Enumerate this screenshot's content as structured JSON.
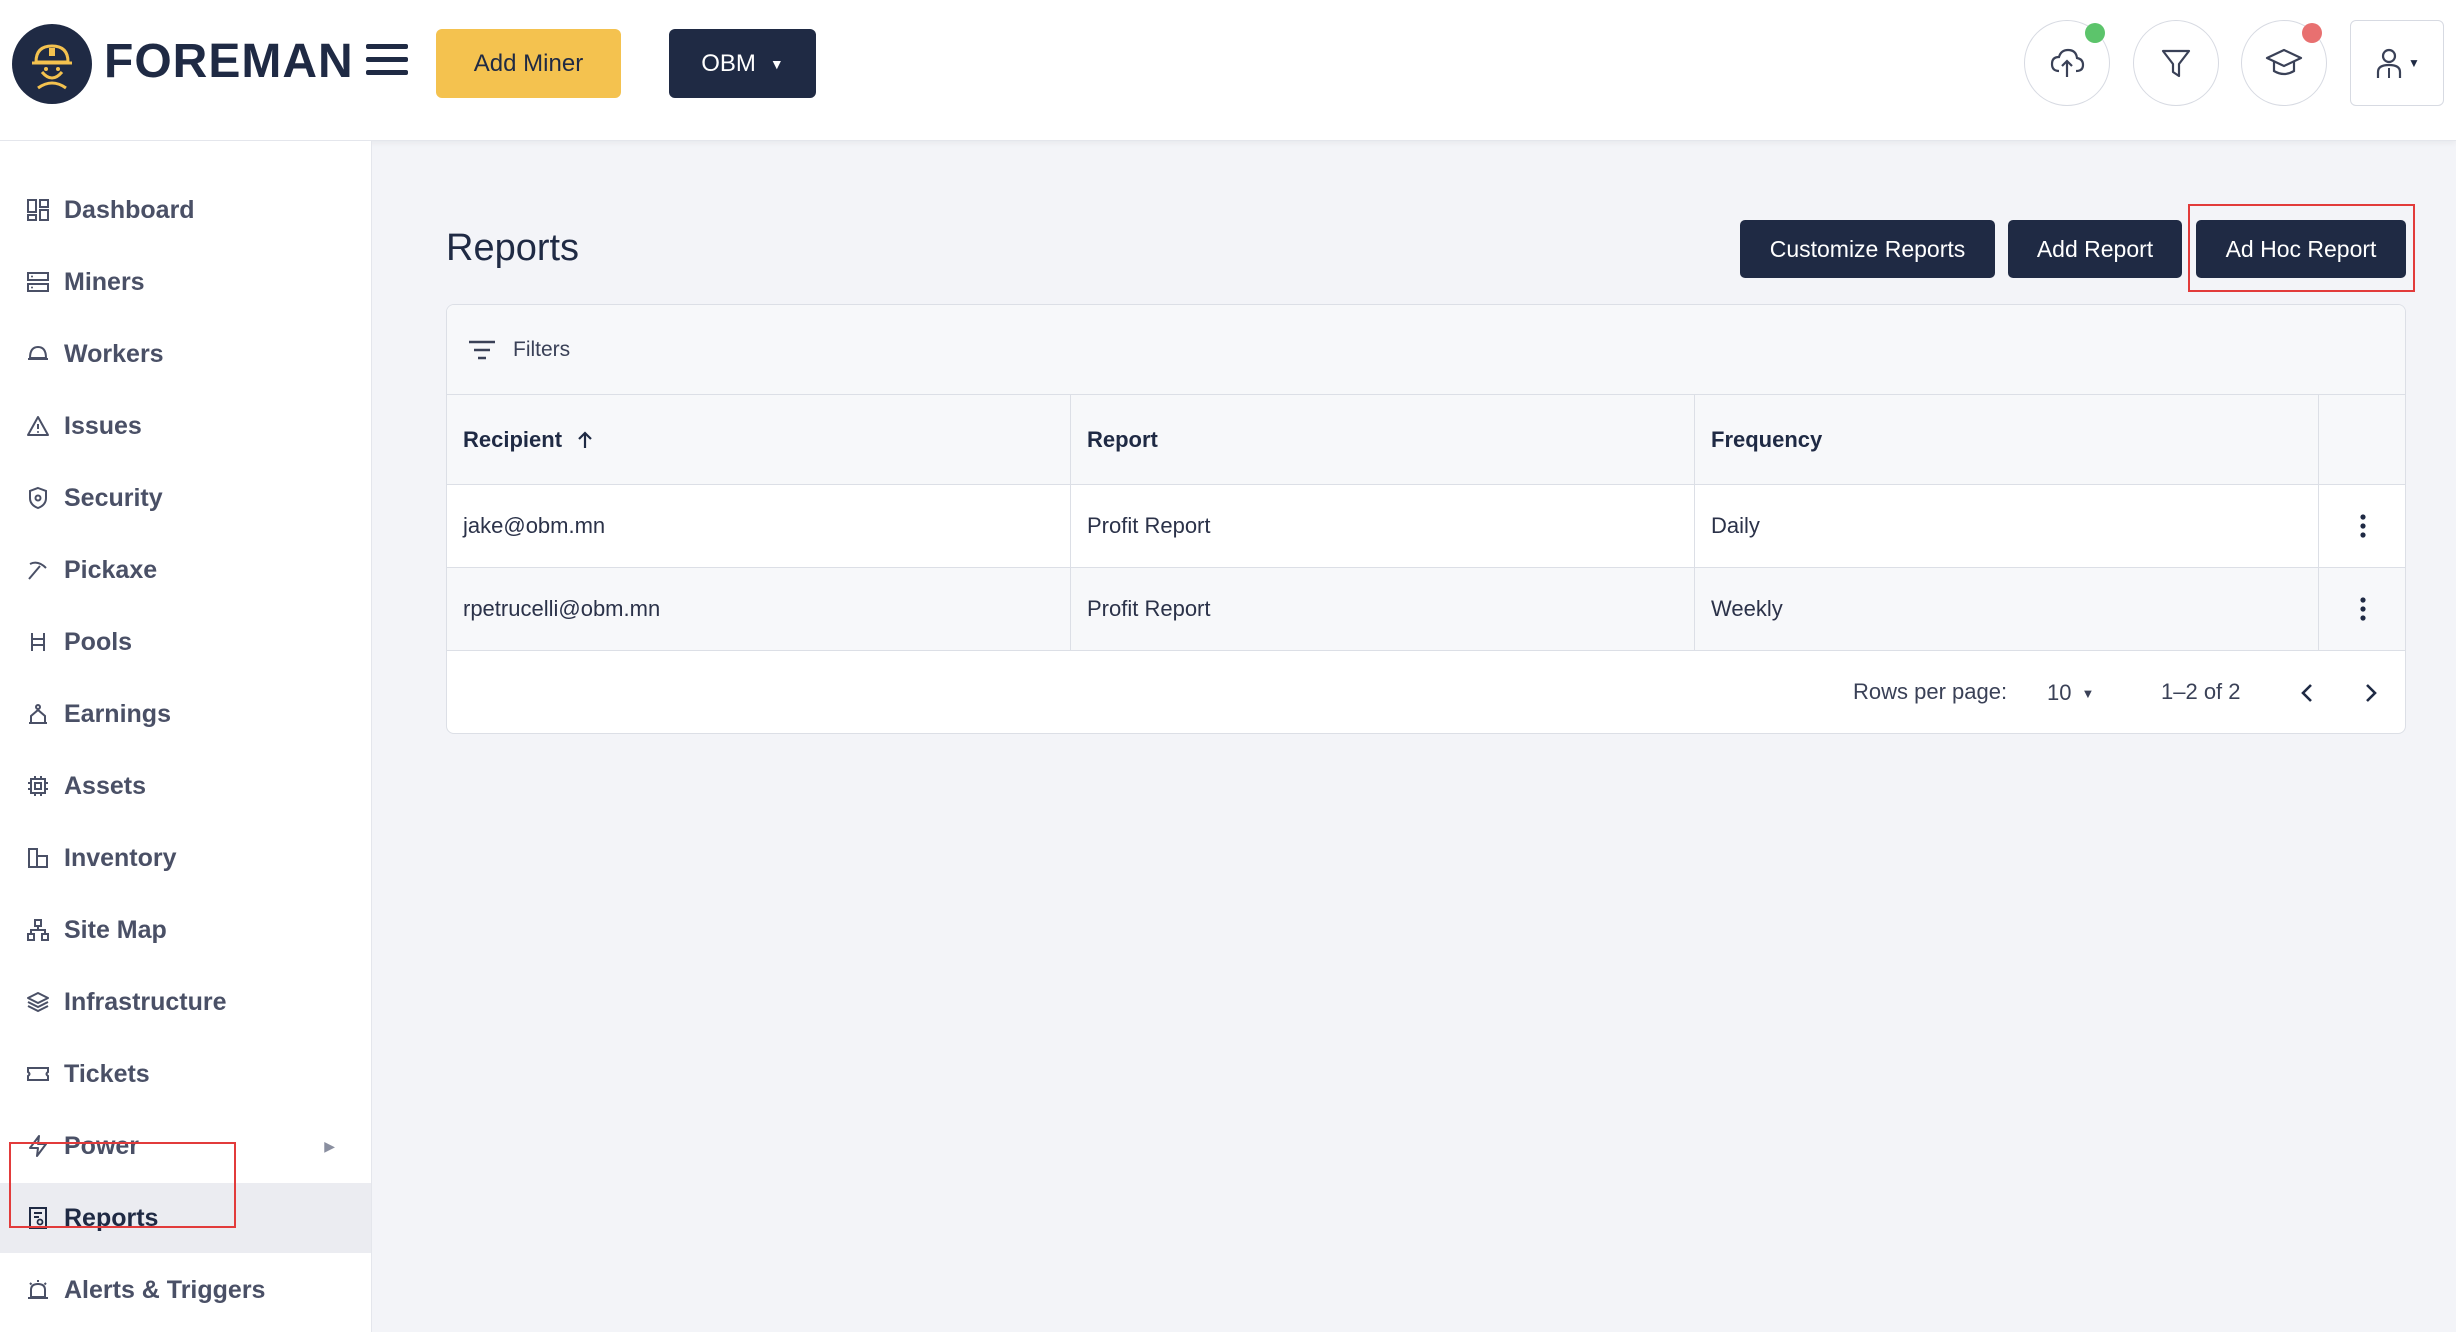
{
  "header": {
    "brand": "FOREMAN",
    "add_miner_label": "Add Miner",
    "org_selector_label": "OBM",
    "icons": [
      "cloud-upload-icon",
      "filter-icon",
      "graduation-cap-icon",
      "user-icon"
    ],
    "status_colors": {
      "upload": "#5cc46b",
      "notifications": "#e87070"
    }
  },
  "sidebar": {
    "items": [
      {
        "label": "Dashboard",
        "icon": "dashboard-icon"
      },
      {
        "label": "Miners",
        "icon": "server-icon"
      },
      {
        "label": "Workers",
        "icon": "helmet-icon"
      },
      {
        "label": "Issues",
        "icon": "warning-icon"
      },
      {
        "label": "Security",
        "icon": "shield-icon"
      },
      {
        "label": "Pickaxe",
        "icon": "pickaxe-icon"
      },
      {
        "label": "Pools",
        "icon": "pools-icon"
      },
      {
        "label": "Earnings",
        "icon": "earnings-icon"
      },
      {
        "label": "Assets",
        "icon": "chip-icon"
      },
      {
        "label": "Inventory",
        "icon": "inventory-icon"
      },
      {
        "label": "Site Map",
        "icon": "sitemap-icon"
      },
      {
        "label": "Infrastructure",
        "icon": "layers-icon"
      },
      {
        "label": "Tickets",
        "icon": "ticket-icon"
      },
      {
        "label": "Power",
        "icon": "bolt-icon"
      },
      {
        "label": "Reports",
        "icon": "report-icon"
      },
      {
        "label": "Alerts & Triggers",
        "icon": "alarm-icon"
      }
    ],
    "active": "Reports"
  },
  "main": {
    "title": "Reports",
    "actions": {
      "customize": "Customize Reports",
      "add": "Add Report",
      "ad_hoc": "Ad Hoc Report"
    },
    "filters_label": "Filters",
    "table": {
      "columns": [
        "Recipient",
        "Report",
        "Frequency"
      ],
      "sort": {
        "column": "Recipient",
        "direction": "ascending"
      },
      "rows": [
        {
          "recipient": "jake@obm.mn",
          "report": "Profit Report",
          "frequency": "Daily"
        },
        {
          "recipient": "rpetrucelli@obm.mn",
          "report": "Profit Report",
          "frequency": "Weekly"
        }
      ]
    },
    "pagination": {
      "rows_per_page_label": "Rows per page:",
      "rows_per_page": "10",
      "range": "1–2 of 2"
    }
  },
  "colors": {
    "primary": "#1f2a44",
    "accent": "#f4c24f",
    "highlight": "#e23b3b"
  }
}
